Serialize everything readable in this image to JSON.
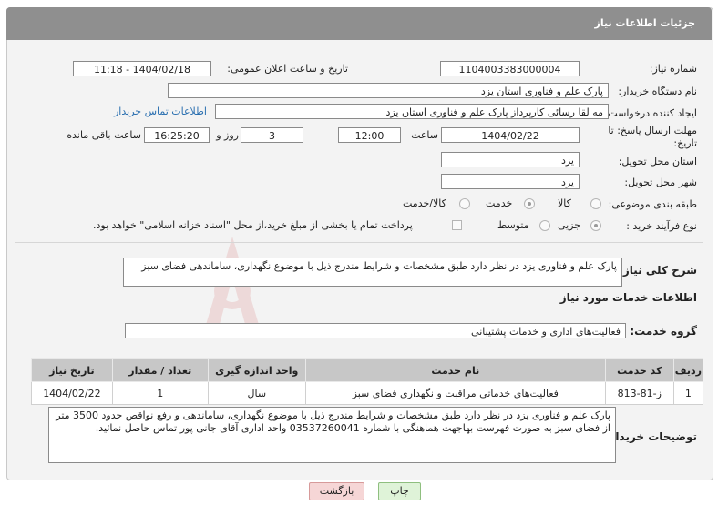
{
  "header": {
    "title": "جزئیات اطلاعات نیاز"
  },
  "fields": {
    "need_number_label": "شماره نیاز:",
    "need_number": "1104003383000004",
    "announce_label": "تاریخ و ساعت اعلان عمومی:",
    "announce_value": "1404/02/18 - 11:18",
    "buyer_label": "نام دستگاه خریدار:",
    "buyer_value": "پارک علم و فناوری استان یزد",
    "creator_label": "ایجاد کننده درخواست:",
    "creator_value": "مه لقا رسائی  کارپرداز پارک علم و فناوری استان یزد",
    "contact_link": "اطلاعات تماس خریدار",
    "deadline_label_1": "مهلت ارسال پاسخ: تا",
    "deadline_label_2": "تاریخ:",
    "deadline_date": "1404/02/22",
    "hour_label": "ساعت",
    "deadline_time": "12:00",
    "days_value": "3",
    "days_label": "روز و",
    "remain_time": "16:25:20",
    "remain_label": "ساعت باقی مانده",
    "province_label": "استان محل تحویل:",
    "province_value": "یزد",
    "city_label": "شهر محل تحویل:",
    "city_value": "یزد",
    "category_label": "طبقه بندی موضوعی:",
    "category_options": [
      "کالا",
      "خدمت",
      "کالا/خدمت"
    ],
    "category_selected": "خدمت",
    "process_label": "نوع فرآیند خرید :",
    "process_options": [
      "جزیی",
      "متوسط"
    ],
    "process_selected": "جزیی",
    "treasury_note": "پرداخت تمام یا بخشی از مبلغ خرید،از محل \"اسناد خزانه اسلامی\" خواهد بود."
  },
  "summary": {
    "label": "شرح کلی نیاز:",
    "text": "پارک علم و فناوری یزد در نظر دارد طبق مشخصات و شرایط مندرج ذیل با موضوع نگهداری، ساماندهی فضای سبز"
  },
  "services": {
    "section_title": "اطلاعات خدمات مورد نیاز",
    "group_label": "گروه خدمت:",
    "group_value": "فعالیت‌های اداری و خدمات پشتیبانی",
    "columns": [
      "ردیف",
      "کد خدمت",
      "نام خدمت",
      "واحد اندازه گیری",
      "تعداد / مقدار",
      "تاریخ نیاز"
    ],
    "rows": [
      [
        "1",
        "ز-81-813",
        "فعالیت‌های خدماتی مراقبت و نگهداری فضای سبز",
        "سال",
        "1",
        "1404/02/22"
      ]
    ]
  },
  "buyer_notes": {
    "label": "توضیحات خریدار:",
    "text": "پارک علم و فناوری یزد در نظر دارد طبق مشخصات و شرایط مندرج ذیل با موضوع نگهداری، ساماندهی و رفع نواقص حدود 3500 متر از فضای سبز به صورت فهرست بهاجهت هماهنگی با شماره 03537260041 واحد اداری آقای جانی پور تماس حاصل نمائید."
  },
  "buttons": {
    "print": "چاپ",
    "back": "بازگشت"
  },
  "colors": {
    "header": "#8f8f8f",
    "print_btn": "#dff3d8",
    "back_btn": "#f6d6d6"
  }
}
